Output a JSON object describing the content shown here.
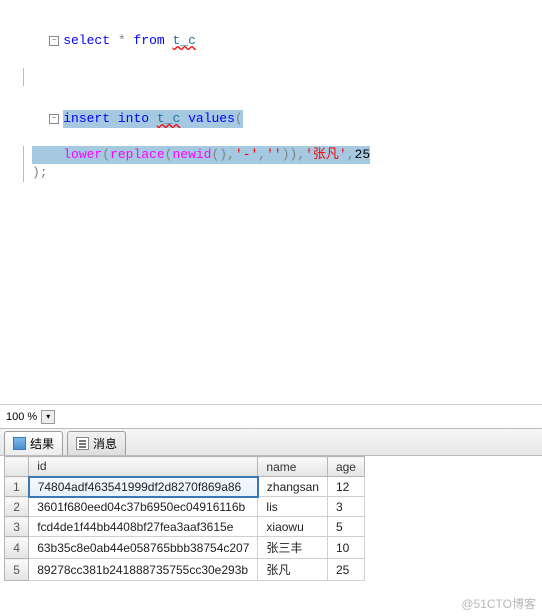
{
  "editor": {
    "line1": {
      "kw1": "select",
      "star": "*",
      "kw2": "from",
      "tbl": "t_c"
    },
    "line3_kw1": "insert",
    "line3_kw2": "into",
    "line3_tbl": "t_c",
    "line3_kw3": "values",
    "line3_paren": "(",
    "line4_fn1": "lower",
    "line4_open1": "(",
    "line4_fn2": "replace",
    "line4_open2": "(",
    "line4_fn3": "newid",
    "line4_parens": "(),",
    "line4_str1": "'-'",
    "line4_comma1": ",",
    "line4_str2": "''",
    "line4_close1": ")),",
    "line4_str3": "'张凡'",
    "line4_comma2": ",",
    "line4_num": "25",
    "line5_close": ");"
  },
  "zoom": {
    "value": "100 %"
  },
  "tabs": {
    "results": "结果",
    "messages": "消息"
  },
  "grid": {
    "headers": {
      "blank": "",
      "id": "id",
      "name": "name",
      "age": "age"
    },
    "rows": [
      {
        "n": "1",
        "id": "74804adf463541999df2d8270f869a86",
        "name": "zhangsan",
        "age": "12"
      },
      {
        "n": "2",
        "id": "3601f680eed04c37b6950ec04916116b",
        "name": "lis",
        "age": "3"
      },
      {
        "n": "3",
        "id": "fcd4de1f44bb4408bf27fea3aaf3615e",
        "name": "xiaowu",
        "age": "5"
      },
      {
        "n": "4",
        "id": "63b35c8e0ab44e058765bbb38754c207",
        "name": "张三丰",
        "age": "10"
      },
      {
        "n": "5",
        "id": "89278cc381b241888735755cc30e293b",
        "name": "张凡",
        "age": "25"
      }
    ]
  },
  "watermark": "@51CTO博客"
}
